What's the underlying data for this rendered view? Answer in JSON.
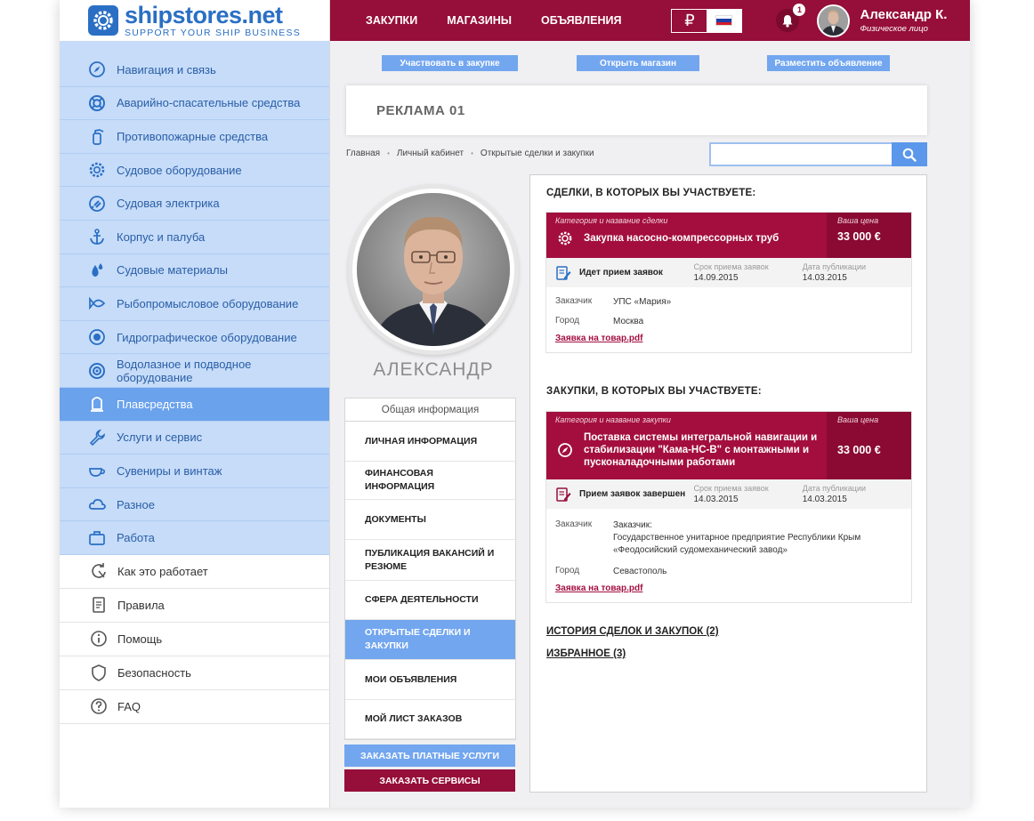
{
  "logo": {
    "name": "shipstores.net",
    "slogan": "SUPPORT YOUR SHIP BUSINESS"
  },
  "categories": [
    {
      "label": "Навигация и связь",
      "icon": "compass-icon"
    },
    {
      "label": "Аварийно-спасательные средства",
      "icon": "lifebuoy-icon"
    },
    {
      "label": "Противопожарные средства",
      "icon": "fire-extinguisher-icon"
    },
    {
      "label": "Судовое оборудование",
      "icon": "gear-icon"
    },
    {
      "label": "Судовая электрика",
      "icon": "plug-icon"
    },
    {
      "label": "Корпус и палуба",
      "icon": "anchor-icon"
    },
    {
      "label": "Судовые материалы",
      "icon": "drops-icon"
    },
    {
      "label": "Рыбопромысловое оборудование",
      "icon": "fish-icon"
    },
    {
      "label": "Гидрографическое оборудование",
      "icon": "sonar-icon"
    },
    {
      "label": "Водолазное и подводное оборудование",
      "icon": "diving-icon"
    },
    {
      "label": "Плавсредства",
      "icon": "ship-icon"
    },
    {
      "label": "Услуги и сервис",
      "icon": "wrench-icon"
    },
    {
      "label": "Сувениры и винтаж",
      "icon": "cup-icon"
    },
    {
      "label": "Разное",
      "icon": "cloud-icon"
    },
    {
      "label": "Работа",
      "icon": "briefcase-icon"
    }
  ],
  "active_category_index": 10,
  "info_links": [
    {
      "label": "Как это работает",
      "icon": "refresh-icon"
    },
    {
      "label": "Правила",
      "icon": "document-icon"
    },
    {
      "label": "Помощь",
      "icon": "info-icon"
    },
    {
      "label": "Безопасность",
      "icon": "shield-icon"
    },
    {
      "label": "FAQ",
      "icon": "question-icon"
    }
  ],
  "topnav": {
    "purchases": "ЗАКУПКИ",
    "shops": "МАГАЗИНЫ",
    "ads": "ОБЪЯВЛЕНИЯ"
  },
  "currency": "₽",
  "notifications_count": "1",
  "user": {
    "name": "Александр К.",
    "type": "Физическое лицо"
  },
  "actions": {
    "join": "Участвовать в закупке",
    "open_shop": "Открыть магазин",
    "post_ad": "Разместить объявление"
  },
  "banner": "РЕКЛАМА 01",
  "breadcrumb": [
    "Главная",
    "Личный кабинет",
    "Открытые сделки и закупки"
  ],
  "search": {
    "value": "",
    "placeholder": ""
  },
  "profile": {
    "name": "АЛЕКСАНДР",
    "menu_header": "Общая информация",
    "menu": [
      "ЛИЧНАЯ ИНФОРМАЦИЯ",
      "ФИНАНСОВАЯ ИНФОРМАЦИЯ",
      "ДОКУМЕНТЫ",
      "ПУБЛИКАЦИЯ ВАКАНСИЙ И РЕЗЮМЕ",
      "СФЕРА ДЕЯТЕЛЬНОСТИ",
      "ОТКРЫТЫЕ СДЕЛКИ И ЗАКУПКИ",
      "МОИ ОБЪЯВЛЕНИЯ",
      "МОЙ ЛИСТ ЗАКАЗОВ"
    ],
    "active_menu_index": 5,
    "btn_paid": "ЗАКАЗАТЬ ПЛАТНЫЕ УСЛУГИ",
    "btn_services": "ЗАКАЗАТЬ СЕРВИСЫ"
  },
  "deals": {
    "title": "СДЕЛКИ, В КОТОРЫХ ВЫ УЧАСТВУЕТЕ:",
    "head_label": "Категория и название сделки",
    "price_label": "Ваша цена",
    "name": "Закупка насосно-компрессорных труб",
    "price": "33 000  €",
    "status": "Идет прием заявок",
    "deadline_label": "Срок приема заявок",
    "deadline": "14.09.2015",
    "pub_label": "Дата публикации",
    "pub_date": "14.03.2015",
    "customer_label": "Заказчик",
    "customer": "УПС «Мария»",
    "city_label": "Город",
    "city": "Москва",
    "file": "Заявка на товар.pdf"
  },
  "purchases": {
    "title": "ЗАКУПКИ, В КОТОРЫХ ВЫ УЧАСТВУЕТЕ:",
    "head_label": "Категория и название закупки",
    "price_label": "Ваша цена",
    "name": "Поставка системы интегральной навигации и стабилизации \"Кама-НС-В\" с монтажными и пусконаладочными работами",
    "price": "33 000  €",
    "status": "Прием заявок завершен",
    "deadline_label": "Срок приема заявок",
    "deadline": "14.03.2015",
    "pub_label": "Дата публикации",
    "pub_date": "14.03.2015",
    "customer_label": "Заказчик",
    "customer_line1": "Заказчик:",
    "customer_line2": "Государственное унитарное предприятие Республики Крым",
    "customer_line3": "«Феодосийский судомеханический завод»",
    "city_label": "Город",
    "city": "Севастополь",
    "file": "Заявка на товар.pdf"
  },
  "history": "ИСТОРИЯ СДЕЛОК И ЗАКУПОК  (2)",
  "favorites": "ИЗБРАННОЕ (3)",
  "colors": {
    "brand_blue": "#2a6fc4",
    "maroon": "#960e3a",
    "sidebar_bg": "#c6dcf9",
    "active_blue": "#6aa2ec"
  }
}
